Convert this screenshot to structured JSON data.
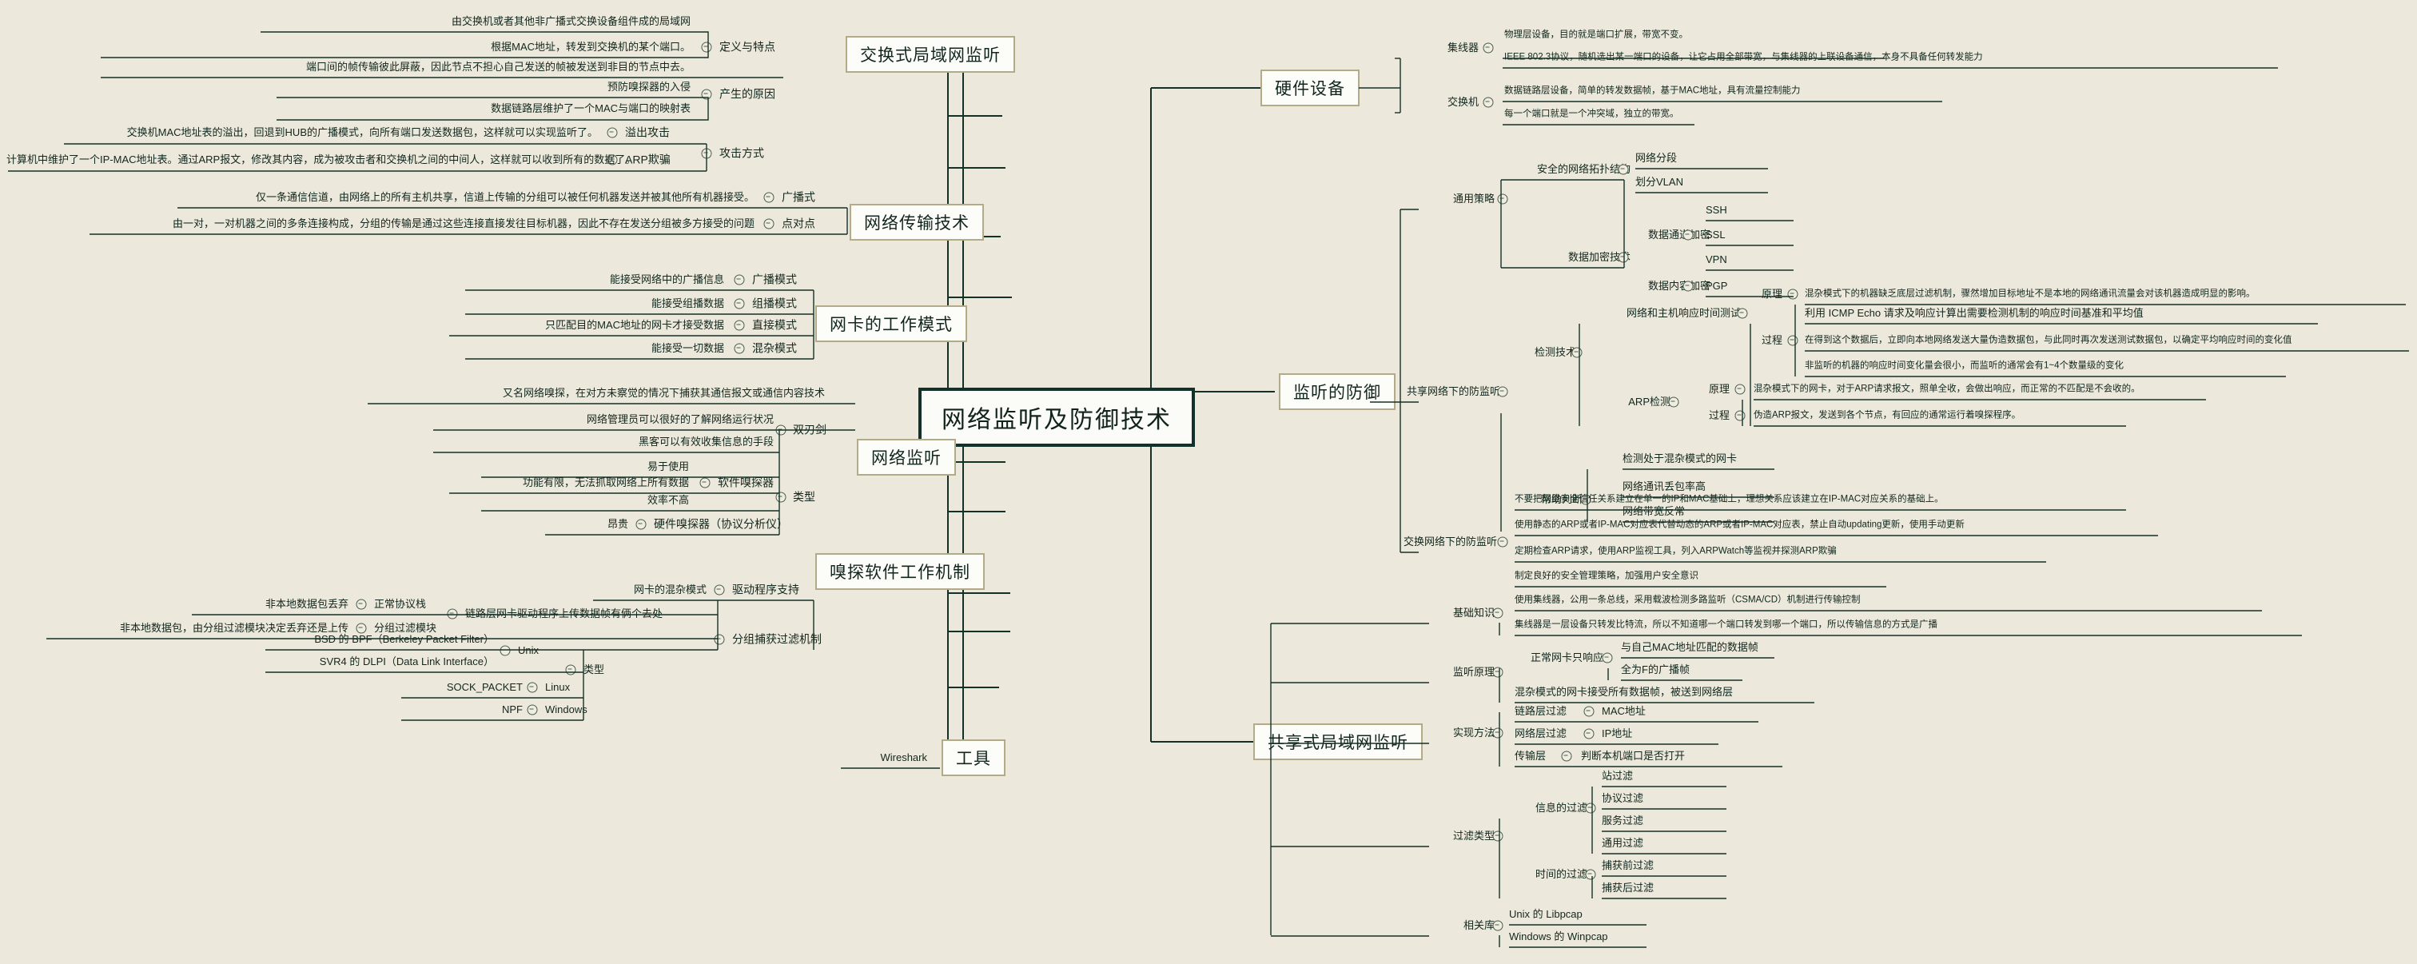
{
  "root": {
    "label": "网络监听及防御技术"
  },
  "branches_left": [
    {
      "label": "交换式局域网监听"
    },
    {
      "label": "网络传输技术"
    },
    {
      "label": "网卡的工作模式"
    },
    {
      "label": "网络监听"
    },
    {
      "label": "嗅探软件工作机制"
    },
    {
      "label": "工具"
    }
  ],
  "branches_right": [
    {
      "label": "硬件设备"
    },
    {
      "label": "监听的防御"
    },
    {
      "label": "共享式局域网监听"
    }
  ],
  "switched_lan": {
    "def_label": "定义与特点",
    "def_items": [
      "由交换机或者其他非广播式交换设备组件成的局域网",
      "根据MAC地址，转发到交换机的某个端口。",
      "端口间的帧传输彼此屏蔽，因此节点不担心自己发送的帧被发送到非目的节点中去。"
    ],
    "cause_label": "产生的原因",
    "cause_items": [
      "预防嗅探器的入侵",
      "数据链路层维护了一个MAC与端口的映射表"
    ],
    "attack_label": "攻击方式",
    "attack_children": [
      {
        "label": "溢出攻击",
        "detail": "交换机MAC地址表的溢出，回退到HUB的广播模式，向所有端口发送数据包，这样就可以实现监听了。"
      },
      {
        "label": "ARP欺骗",
        "detail": "计算机中维护了一个IP-MAC地址表。通过ARP报文，修改其内容，成为被攻击者和交换机之间的中间人，这样就可以收到所有的数据了。"
      }
    ]
  },
  "transmission": [
    {
      "label": "广播式",
      "detail": "仅一条通信信道，由网络上的所有主机共享，信道上传输的分组可以被任何机器发送并被其他所有机器接受。"
    },
    {
      "label": "点对点",
      "detail": "由一对，一对机器之间的多条连接构成，分组的传输是通过这些连接直接发往目标机器，因此不存在发送分组被多方接受的问题"
    }
  ],
  "nic_modes": [
    {
      "label": "广播模式",
      "detail": "能接受网络中的广播信息"
    },
    {
      "label": "组播模式",
      "detail": "能接受组播数据"
    },
    {
      "label": "直接模式",
      "detail": "只匹配目的MAC地址的网卡才接受数据"
    },
    {
      "label": "混杂模式",
      "detail": "能接受一切数据"
    }
  ],
  "sniffing": {
    "desc": "又名网络嗅探，在对方未察觉的情况下捕获其通信报文或通信内容技术",
    "double_edge_label": "双刃剑",
    "double_edge_items": [
      "网络管理员可以很好的了解网络运行状况",
      "黑客可以有效收集信息的手段"
    ],
    "type_label": "类型",
    "types": [
      {
        "label": "软件嗅探器",
        "items": [
          "易于使用",
          "功能有限，无法抓取网络上所有数据",
          "效率不高"
        ]
      },
      {
        "label": "硬件嗅探器（协议分析仪）",
        "items": [
          "昂贵"
        ]
      }
    ]
  },
  "sniffer_mech": {
    "driver_label": "驱动程序支持",
    "driver_detail": "网卡的混杂模式",
    "capture_label": "分组捕获过滤机制",
    "link_label": "链路层网卡驱动程序上传数据帧有俩个去处",
    "link_children": [
      {
        "label": "正常协议栈",
        "detail": "非本地数据包丢弃"
      },
      {
        "label": "分组过滤模块",
        "detail": "非本地数据包，由分组过滤模块决定丢弃还是上传"
      }
    ],
    "type_label": "类型",
    "types": [
      {
        "os": "Unix",
        "items": [
          "BSD 的 BPF（Berkeley Packet Filter）",
          "SVR4 的 DLPI（Data Link Interface）"
        ]
      },
      {
        "os": "Linux",
        "items": [
          "SOCK_PACKET"
        ]
      },
      {
        "os": "Windows",
        "items": [
          "NPF"
        ]
      }
    ]
  },
  "tools": {
    "items": [
      "Wireshark"
    ]
  },
  "hardware": [
    {
      "label": "集线器",
      "items": [
        "物理层设备，目的就是端口扩展，带宽不变。",
        "IEEE 802.3协议，随机选出某一端口的设备，让它占用全部带宽，与集线器的上联设备通信，本身不具备任何转发能力"
      ]
    },
    {
      "label": "交换机",
      "items": [
        "数据链路层设备，简单的转发数据帧，基于MAC地址，具有流量控制能力",
        "每一个端口就是一个冲突域，独立的带宽。"
      ]
    }
  ],
  "defense": {
    "general_label": "通用策略",
    "topology_label": "安全的网络拓扑结构",
    "topology_items": [
      "网络分段",
      "划分VLAN"
    ],
    "encrypt_label": "数据加密技术",
    "channel_label": "数据通道加密",
    "channel_items": [
      "SSH",
      "SSL",
      "VPN"
    ],
    "content_label": "数据内容加密",
    "content_items": [
      "PGP"
    ],
    "shared_label": "共享网络下的防监听",
    "detect_label": "检测技术",
    "rtt_label": "网络和主机响应时间测试",
    "rtt_principle_label": "原理",
    "rtt_principle": "混杂模式下的机器缺乏底层过滤机制，骤然增加目标地址不是本地的网络通讯流量会对该机器造成明显的影响。",
    "rtt_process_label": "过程",
    "rtt_process_items": [
      "利用 ICMP Echo 请求及响应计算出需要检测机制的响应时间基准和平均值",
      "在得到这个数据后，立即向本地网络发送大量伪造数据包，与此同时再次发送测试数据包，以确定平均响应时间的变化值",
      "非监听的机器的响应时间变化量会很小，而监听的通常会有1~4个数量级的变化"
    ],
    "arp_label": "ARP检测",
    "arp_principle_label": "原理",
    "arp_principle": "混杂模式下的网卡，对于ARP请求报文，照单全收，会做出响应，而正常的不匹配是不会收的。",
    "arp_process_label": "过程",
    "arp_process": "伪造ARP报文，发送到各个节点，有回应的通常运行着嗅探程序。",
    "nic_detect": "检测处于混杂模式的网卡",
    "help_label": "帮助判断",
    "help_items": [
      "网络通讯丢包率高",
      "网络带宽反常"
    ],
    "switched_label": "交换网络下的防监听",
    "switched_items": [
      "不要把网络安全信任关系建立在单一的IP和MAC基础上，理想关系应该建立在IP-MAC对应关系的基础上。",
      "使用静态的ARP或者IP-MAC对应表代替动态的ARP或者IP-MAC对应表，禁止自动updating更新，使用手动更新",
      "定期检查ARP请求，使用ARP监视工具，列入ARPWatch等监视并探测ARP欺骗",
      "制定良好的安全管理策略，加强用户安全意识"
    ]
  },
  "shared_lan": {
    "basic_label": "基础知识",
    "basic_items": [
      "使用集线器，公用一条总线，采用载波检测多路监听（CSMA/CD）机制进行传输控制",
      "集线器是一层设备只转发比特流，所以不知道哪一个端口转发到哪一个端口，所以传输信息的方式是广播"
    ],
    "principle_label": "监听原理",
    "normal_label": "正常网卡只响应",
    "normal_items": [
      "与自己MAC地址匹配的数据帧",
      "全为F的广播帧"
    ],
    "promisc_item": "混杂模式的网卡接受所有数据帧，被送到网络层",
    "method_label": "实现方法",
    "methods": [
      {
        "label": "链路层过滤",
        "detail": "MAC地址"
      },
      {
        "label": "网络层过滤",
        "detail": "IP地址"
      },
      {
        "label": "传输层",
        "detail": "判断本机端口是否打开"
      }
    ],
    "filter_label": "过滤类型",
    "info_filter_label": "信息的过滤",
    "info_filter_items": [
      "站过滤",
      "协议过滤",
      "服务过滤",
      "通用过滤"
    ],
    "time_filter_label": "时间的过滤",
    "time_filter_items": [
      "捕获前过滤",
      "捕获后过滤"
    ],
    "lib_label": "相关库",
    "lib_items": [
      "Unix 的 Libpcap",
      "Windows 的 Winpcap"
    ]
  }
}
